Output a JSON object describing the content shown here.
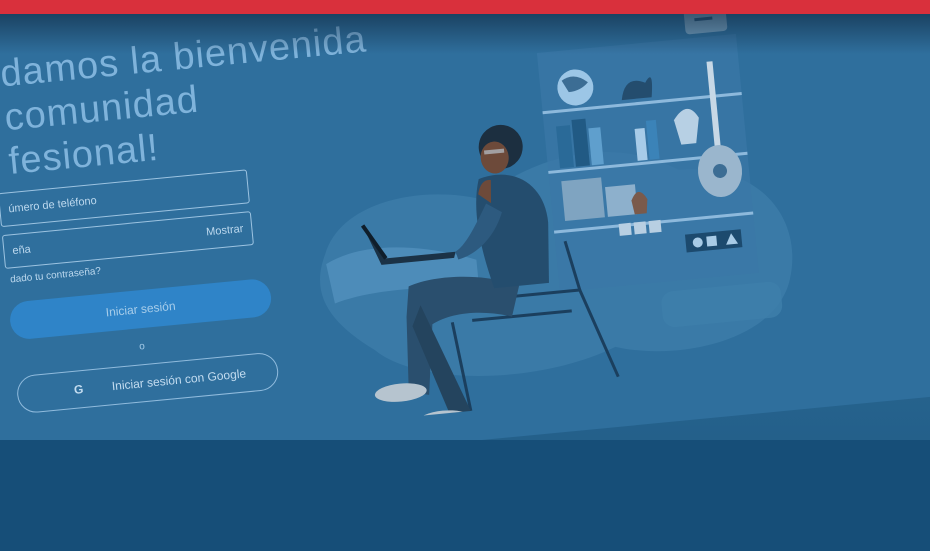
{
  "login": {
    "headline_line1": "damos la bienvenida",
    "headline_line2": "comunidad",
    "headline_line3": "fesional!",
    "phone_placeholder": "úmero de teléfono",
    "password_placeholder": "eña",
    "show_label": "Mostrar",
    "forgot_label": "dado tu contraseña?",
    "signin_label": "Iniciar sesión",
    "or_label": "o",
    "google_icon_letter": "G",
    "google_label": "Iniciar sesión con Google"
  },
  "colors": {
    "top_bar": "#d9303c",
    "overlay": "#245a82",
    "primary_button": "#2f84c8"
  },
  "icons": [
    "google-icon"
  ]
}
